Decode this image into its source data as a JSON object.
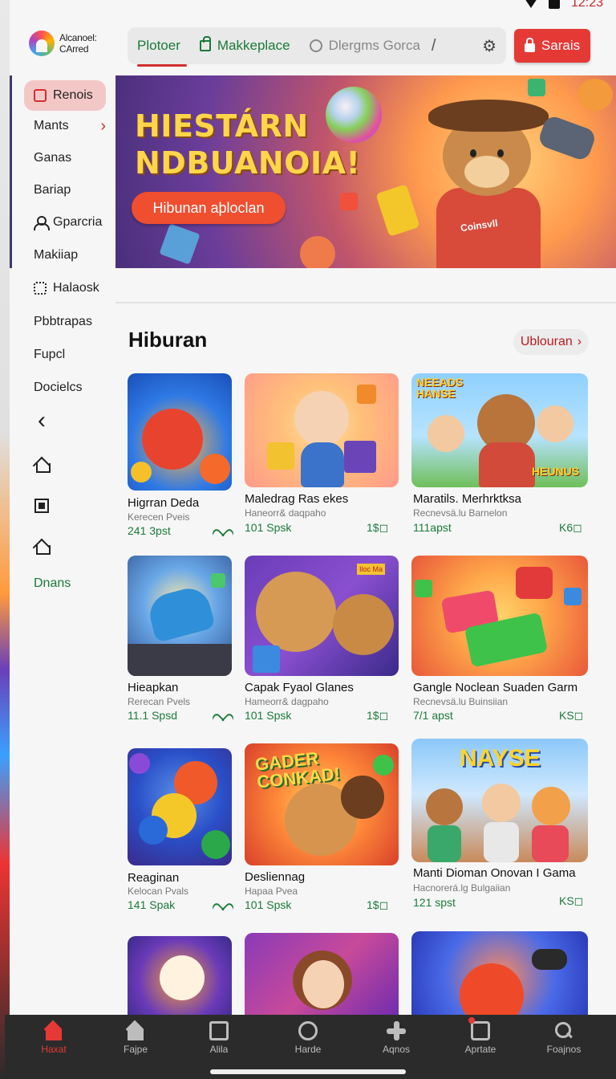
{
  "status": {
    "time": "12:23"
  },
  "header": {
    "logo_line1": "Alcanoel:",
    "logo_line2": "CArred",
    "tabs": [
      {
        "label": "Plotoer",
        "active": true
      },
      {
        "label": "Makkeplace",
        "icon": "bag-icon"
      },
      {
        "label": "Dlergms Gorca",
        "icon": "globe-icon"
      }
    ],
    "slash": "/",
    "cta_label": "Sarais"
  },
  "sidebar": {
    "items": [
      {
        "label": "Renois",
        "active": true,
        "icon": "document-icon"
      },
      {
        "label": "Mants",
        "chevron": "›"
      },
      {
        "label": "Ganas"
      },
      {
        "label": "Bariap"
      },
      {
        "label": "Gparcria",
        "icon": "person-icon"
      },
      {
        "label": "Makiiap"
      },
      {
        "label": "Halaosk",
        "icon": "grid-icon"
      },
      {
        "label": "Pbbtrapas"
      },
      {
        "label": "Fupcl"
      },
      {
        "label": "Docielcs"
      }
    ],
    "icon_back": "‹",
    "bottom_label": "Dnans"
  },
  "banner": {
    "title_line1": "HIESTÁRN",
    "title_line2": "NDBUANOIA!",
    "button_label": "Hibunan aþloclan",
    "shirt_text": "Coinsvll"
  },
  "section": {
    "title": "Hiburan",
    "more_label": "Ublouran",
    "more_chevron": "›"
  },
  "cards": [
    {
      "title": "Higrran Deda",
      "sub": "Kerecen Pveis",
      "rate": "241 3pst",
      "tag": "",
      "heart": true
    },
    {
      "title": "Maledrag Ras ekes",
      "sub": "Haneorr& daqpaho",
      "rate": "101 Spsk",
      "tag": "1$◻"
    },
    {
      "title": "Maratils. Merhrktksa",
      "sub": "Recnevsä.lu Barnelon",
      "rate": "111apst",
      "tag": "K6◻",
      "badge1": "NEEADS HANSE",
      "badge2": "HEUNUS"
    },
    {
      "title": "Hieapkan",
      "sub": "Rerecan Pvels",
      "rate": "11.1 Spsd",
      "tag": "",
      "heart": true
    },
    {
      "title": "Capak Fyaol Glanes",
      "sub": "Hameorr& dagpaho",
      "rate": "101 Spsk",
      "tag": "1$◻",
      "badge1": "Iloc Ma"
    },
    {
      "title": "Gangle Noclean Suaden Garm",
      "sub": "Recnevsä.lu Buinsiian",
      "rate": "7/1 apst",
      "tag": "KS◻"
    },
    {
      "title": "Reaginan",
      "sub": "Kelocan Pvals",
      "rate": "141 Spak",
      "tag": "",
      "heart": true
    },
    {
      "title": "Desliennag",
      "sub": "Hapaa Pvea",
      "rate": "101 Spsk",
      "tag": "1$◻",
      "badge1": "GADER CONKAD!"
    },
    {
      "title": "Manti Dioman Onovan I Gama",
      "sub": "Hacnorerá.lg Bulgaiian",
      "rate": "121 spst",
      "tag": "KS◻",
      "badge1": "NAYSE"
    }
  ],
  "bottom_tabs": [
    {
      "label": "Haxat",
      "icon": "home-icon",
      "active": true
    },
    {
      "label": "Fajpe",
      "icon": "home-icon"
    },
    {
      "label": "Alila",
      "icon": "image-icon"
    },
    {
      "label": "Harde",
      "icon": "ring-icon"
    },
    {
      "label": "Aqnos",
      "icon": "plus-icon"
    },
    {
      "label": "Aprtate",
      "icon": "box-icon"
    },
    {
      "label": "Foajnos",
      "icon": "search-icon"
    }
  ]
}
